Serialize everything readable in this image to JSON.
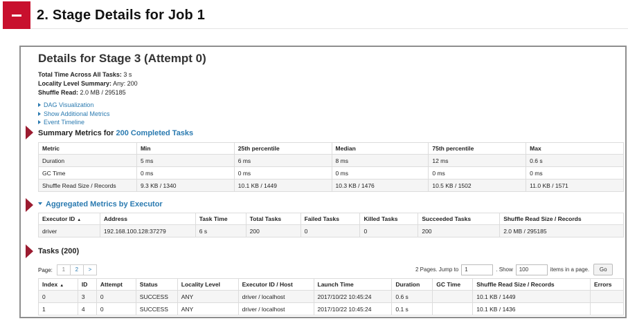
{
  "section": {
    "title": "2. Stage Details for Job 1"
  },
  "stage": {
    "title": "Details for Stage 3 (Attempt 0)",
    "summary": [
      {
        "label": "Total Time Across All Tasks:",
        "value": "3 s"
      },
      {
        "label": "Locality Level Summary:",
        "value": "Any: 200"
      },
      {
        "label": "Shuffle Read:",
        "value": "2.0 MB / 295185"
      }
    ],
    "links": [
      "DAG Visualization",
      "Show Additional Metrics",
      "Event Timeline"
    ]
  },
  "summary_metrics": {
    "heading_prefix": "Summary Metrics for ",
    "heading_accent": "200 Completed Tasks",
    "columns": [
      "Metric",
      "Min",
      "25th percentile",
      "Median",
      "75th percentile",
      "Max"
    ],
    "rows": [
      [
        "Duration",
        "5 ms",
        "6 ms",
        "8 ms",
        "12 ms",
        "0.6 s"
      ],
      [
        "GC Time",
        "0 ms",
        "0 ms",
        "0 ms",
        "0 ms",
        "0 ms"
      ],
      [
        "Shuffle Read Size / Records",
        "9.3 KB / 1340",
        "10.1 KB / 1449",
        "10.3 KB / 1476",
        "10.5 KB / 1502",
        "11.0 KB / 1571"
      ]
    ]
  },
  "executors": {
    "heading": "Aggregated Metrics by Executor",
    "columns": [
      "Executor ID",
      "Address",
      "Task Time",
      "Total Tasks",
      "Failed Tasks",
      "Killed Tasks",
      "Succeeded Tasks",
      "Shuffle Read Size / Records"
    ],
    "sort_marker": "▲",
    "rows": [
      [
        "driver",
        "192.168.100.128:37279",
        "6 s",
        "200",
        "0",
        "0",
        "200",
        "2.0 MB / 295185"
      ]
    ]
  },
  "tasks": {
    "heading": "Tasks (200)",
    "pager": {
      "page_label": "Page:",
      "pages": [
        "1",
        "2",
        ">"
      ],
      "summary": "2 Pages. Jump to",
      "jump_value": "1",
      "show_label": ". Show",
      "show_value": "100",
      "items_label": "items in a page.",
      "go_label": "Go"
    },
    "columns": [
      "Index",
      "ID",
      "Attempt",
      "Status",
      "Locality Level",
      "Executor ID / Host",
      "Launch Time",
      "Duration",
      "GC Time",
      "Shuffle Read Size / Records",
      "Errors"
    ],
    "sort_marker": "▲",
    "rows": [
      [
        "0",
        "3",
        "0",
        "SUCCESS",
        "ANY",
        "driver / localhost",
        "2017/10/22 10:45:24",
        "0.6 s",
        "",
        "10.1 KB / 1449",
        ""
      ],
      [
        "1",
        "4",
        "0",
        "SUCCESS",
        "ANY",
        "driver / localhost",
        "2017/10/22 10:45:24",
        "0.1 s",
        "",
        "10.1 KB / 1436",
        ""
      ]
    ]
  },
  "colors": {
    "brand": "#c8102e",
    "marker": "#9b1b30",
    "link": "#2a7ab0"
  }
}
